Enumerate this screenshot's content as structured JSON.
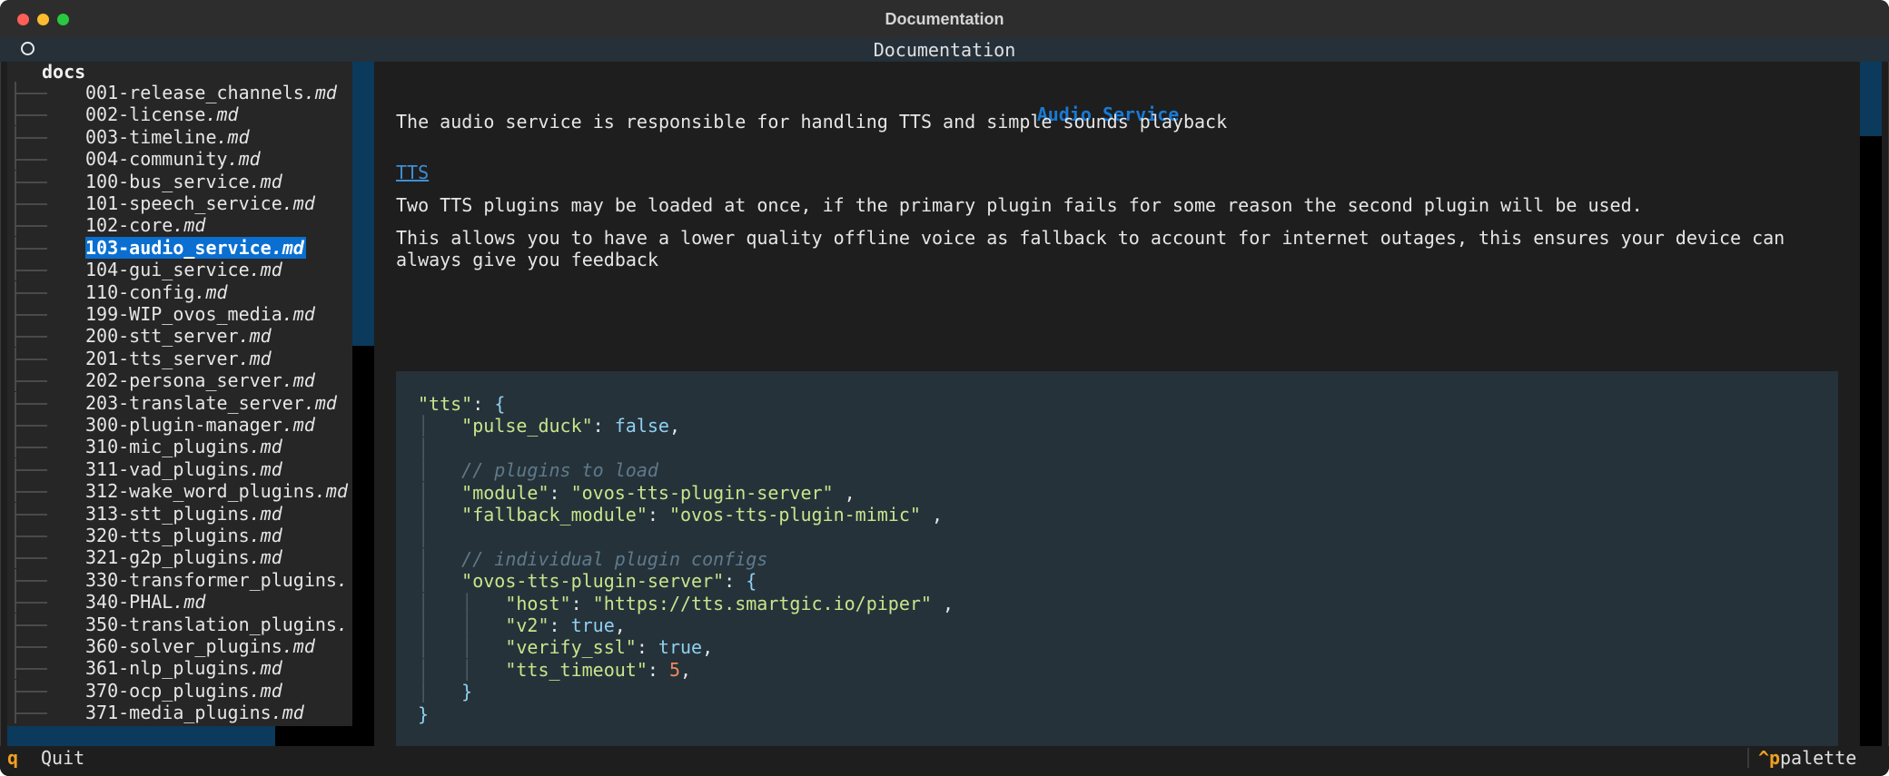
{
  "window": {
    "title": "Documentation"
  },
  "header": {
    "title": "Documentation"
  },
  "tree": {
    "root": "docs",
    "items": [
      {
        "name": "001-release_channels",
        "ext": ".md"
      },
      {
        "name": "002-license",
        "ext": ".md"
      },
      {
        "name": "003-timeline",
        "ext": ".md"
      },
      {
        "name": "004-community",
        "ext": ".md"
      },
      {
        "name": "100-bus_service",
        "ext": ".md"
      },
      {
        "name": "101-speech_service",
        "ext": ".md"
      },
      {
        "name": "102-core",
        "ext": ".md"
      },
      {
        "name": "103-audio_service",
        "ext": ".md",
        "selected": true
      },
      {
        "name": "104-gui_service",
        "ext": ".md"
      },
      {
        "name": "110-config",
        "ext": ".md"
      },
      {
        "name": "199-WIP_ovos_media",
        "ext": ".md"
      },
      {
        "name": "200-stt_server",
        "ext": ".md"
      },
      {
        "name": "201-tts_server",
        "ext": ".md"
      },
      {
        "name": "202-persona_server",
        "ext": ".md"
      },
      {
        "name": "203-translate_server",
        "ext": ".md"
      },
      {
        "name": "300-plugin-manager",
        "ext": ".md"
      },
      {
        "name": "310-mic_plugins",
        "ext": ".md"
      },
      {
        "name": "311-vad_plugins",
        "ext": ".md"
      },
      {
        "name": "312-wake_word_plugins",
        "ext": ".md"
      },
      {
        "name": "313-stt_plugins",
        "ext": ".md"
      },
      {
        "name": "320-tts_plugins",
        "ext": ".md"
      },
      {
        "name": "321-g2p_plugins",
        "ext": ".md"
      },
      {
        "name": "330-transformer_plugins",
        "ext": "."
      },
      {
        "name": "340-PHAL",
        "ext": ".md"
      },
      {
        "name": "350-translation_plugins",
        "ext": "."
      },
      {
        "name": "360-solver_plugins",
        "ext": ".md"
      },
      {
        "name": "361-nlp_plugins",
        "ext": ".md"
      },
      {
        "name": "370-ocp_plugins",
        "ext": ".md"
      },
      {
        "name": "371-media_plugins",
        "ext": ".md"
      }
    ]
  },
  "content": {
    "heading": "Audio Service",
    "intro": "The audio service is responsible for handling TTS and simple sounds playback",
    "link": "TTS",
    "para1": "Two TTS plugins may be loaded at once, if the primary plugin fails for some reason the second plugin will be used.",
    "para2_line1": "This allows you to have a lower quality offline voice as fallback to account for internet outages, this ensures your device can",
    "para2_line2": "always give you feedback",
    "code": [
      [
        [
          "k",
          "\"tts\""
        ],
        [
          "p",
          ": "
        ],
        [
          "b",
          "{"
        ]
      ],
      [
        [
          "pipe",
          "│   "
        ],
        [
          "k",
          "\"pulse_duck\""
        ],
        [
          "p",
          ": "
        ],
        [
          "b",
          "false"
        ],
        [
          "p",
          ","
        ]
      ],
      [
        [
          "pipe",
          "│"
        ]
      ],
      [
        [
          "pipe",
          "│   "
        ],
        [
          "c",
          "// plugins to load"
        ]
      ],
      [
        [
          "pipe",
          "│   "
        ],
        [
          "k",
          "\"module\""
        ],
        [
          "p",
          ": "
        ],
        [
          "s",
          "\"ovos-tts-plugin-server\""
        ],
        [
          "p",
          " ,"
        ]
      ],
      [
        [
          "pipe",
          "│   "
        ],
        [
          "k",
          "\"fallback_module\""
        ],
        [
          "p",
          ": "
        ],
        [
          "s",
          "\"ovos-tts-plugin-mimic\""
        ],
        [
          "p",
          " ,"
        ]
      ],
      [
        [
          "pipe",
          "│"
        ]
      ],
      [
        [
          "pipe",
          "│   "
        ],
        [
          "c",
          "// individual plugin configs"
        ]
      ],
      [
        [
          "pipe",
          "│   "
        ],
        [
          "k",
          "\"ovos-tts-plugin-server\""
        ],
        [
          "p",
          ": "
        ],
        [
          "b",
          "{"
        ]
      ],
      [
        [
          "pipe",
          "│   │   "
        ],
        [
          "k",
          "\"host\""
        ],
        [
          "p",
          ": "
        ],
        [
          "s",
          "\"https://tts.smartgic.io/piper\""
        ],
        [
          "p",
          " ,"
        ]
      ],
      [
        [
          "pipe",
          "│   │   "
        ],
        [
          "k",
          "\"v2\""
        ],
        [
          "p",
          ": "
        ],
        [
          "b",
          "true"
        ],
        [
          "p",
          ","
        ]
      ],
      [
        [
          "pipe",
          "│   │   "
        ],
        [
          "k",
          "\"verify_ssl\""
        ],
        [
          "p",
          ": "
        ],
        [
          "b",
          "true"
        ],
        [
          "p",
          ","
        ]
      ],
      [
        [
          "pipe",
          "│   │   "
        ],
        [
          "k",
          "\"tts_timeout\""
        ],
        [
          "p",
          ": "
        ],
        [
          "n",
          "5"
        ],
        [
          "p",
          ","
        ]
      ],
      [
        [
          "pipe",
          "│   "
        ],
        [
          "b",
          "}"
        ]
      ],
      [
        [
          "b",
          "}"
        ]
      ]
    ]
  },
  "footer": {
    "quit_key": "q",
    "quit_label": "Quit",
    "palette_key": "^p",
    "palette_label": "palette"
  },
  "colors": {
    "accent": "#0a6fd1",
    "heading": "#1a7ad4",
    "key_highlight": "#f0a020"
  }
}
